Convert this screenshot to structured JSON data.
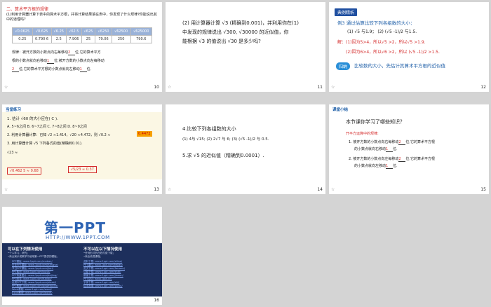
{
  "slides": {
    "s10": {
      "number": "10",
      "section_title": "二、算术平方根的规律",
      "question": "(1)利用计算器计算下表中的算术平方根，并将计算结果填在表中，你发现了什么规律?你能说出其中的道理吗?",
      "table_header": [
        "√0.0625",
        "√0.625",
        "√6.25",
        "√62.5",
        "√625",
        "√6250",
        "√62500",
        "√625000"
      ],
      "table_values": [
        "0.25",
        "0.790 6",
        "2.5",
        "7.906",
        "25",
        "79.06",
        "250",
        "790.6"
      ],
      "rule_text_1": "规律：被开方数的小数点向右每移动",
      "rule_blank_1": "2",
      "rule_text_2": "位,它的算术平方",
      "rule_text_3": "根的小数点就向右移动",
      "rule_blank_2": "1",
      "rule_text_4": "位;被开方数的小数点向左每移动",
      "rule_blank_3": "2",
      "rule_text_5": "位,它的算术平方根的小数点就向左移动",
      "rule_blank_4": "1",
      "rule_text_6": "位."
    },
    "s11": {
      "number": "11",
      "line1": "(2) 用计算器计算 √3 (精确到0.001)，并利用你在(1)",
      "line2": "中发现的规律说出 √300, √30000 的近似值，你",
      "line3": "能根据 √3 的值说出 √30 是多少吗?"
    },
    "s12": {
      "number": "12",
      "badge": "典例精析",
      "example": "例3  通过估算比较下列各组数的大小：",
      "items": "(1) √5 与1.9；        (2) (√5 -1)/2 与1.5.",
      "sol1": "解：(1)因为5>4，所以√5 >2，所以√5 >1.9.",
      "sol2": "(2)因为6>4，所以√6 >2，所以 (√5 -1)/2 >1.5.",
      "hint_label": "归纳",
      "hint": "比较数的大小，先估计其算术平方根的近似值"
    },
    "s13": {
      "number": "13",
      "heading": "当堂练习",
      "q1": "1. 估计 √60 的大小应在( C ).",
      "q1_options": "A. 5~6之间    B. 6~7之间    C. 7~8之间    D. 8~9之间",
      "q2": "2. 利用计算器计算：已知 √2 ≈1.414，√20 ≈4.472，则 √0.2 ≈",
      "q2_answer": "0.4472",
      "q3": "3. 用计算器计算 √5 下列各式的值(精确到0.01).",
      "q3_expr": "√23  ≈",
      "ans1": "√0.462 5 ≈ 0.68",
      "ans2": "√5/23 ≈ 0.37"
    },
    "s14": {
      "number": "14",
      "line1": "4.比较下列各组数的大小",
      "items": "(1) 4与 √15;      (2) 2√7 与 6;     (3) (√5 -1)/2 与 0.5.",
      "line2": "5.求 √5 的近似值（精确到0.0001）."
    },
    "s15": {
      "number": "15",
      "heading": "课堂小结",
      "title": "本节课你学习了哪些知识？",
      "sub": "开平方运算中的规律:",
      "p1a": "1. 被开方数的小数点向右每移动",
      "p1b": "2",
      "p1c": "位,它的算术平方根",
      "p1d": "的小数点就向右移动",
      "p1e": "1",
      "p1f": "位.",
      "p2a": "2. 被开方数的小数点向左每移动",
      "p2b": "2",
      "p2c": "位,它的算术平方根",
      "p2d": "的小数点就向左移动",
      "p2e": "1",
      "p2f": "位."
    },
    "s16": {
      "number": "16",
      "logo": "第一PPT",
      "url": "HTTP://WWW.1PPT.COM",
      "col1_title": "可以在下列情况使用",
      "col2_title": "不可以在以下情况使用",
      "col1_sub": "•个人学习、研究；\n•商业演示或教学中使用第一PPT提供的模板。",
      "col2_sub": "•任何形式的在线付费下载；\n•商业收费课程。",
      "links_left": [
        "PPT模板: www.1ppt.com/moban/",
        "行业PPT模板: www.1ppt.com/hangye/",
        "节日PPT模板: www.1ppt.com/jieri/",
        "PPT素材: www.1ppt.com/sucai/",
        "PPT背景图片: www.1ppt.com/beijing/",
        "PPT图表: www.1ppt.com/tubiao/",
        "优秀PPT下载: www.1ppt.com/xiazai/",
        "PPT教程: www.1ppt.com/powerpoint/",
        "Word教程: www.1ppt.com/word/",
        "Excel教程: www.1ppt.com/excel/"
      ],
      "links_right": [
        "资料下载: www.1ppt.com/ziliao/",
        "PPT课件: www.1ppt.com/kejian/",
        "范文下载: www.1ppt.com/fanwen/",
        "试卷下载: www.1ppt.com/shiti/",
        "教案下载: www.1ppt.com/jiaoan/",
        "PPT论坛: www.1ppt.cn/",
        "字体下载: www.1ppt.com/ziti/",
        "绘本故事: www.1ppt.com/gushi/"
      ]
    }
  },
  "colors": {
    "accent_blue": "#2a6fb5",
    "answer_red": "#d42b2b",
    "panel_dark": "#1d2f5c",
    "background": "#d4d4d4"
  }
}
